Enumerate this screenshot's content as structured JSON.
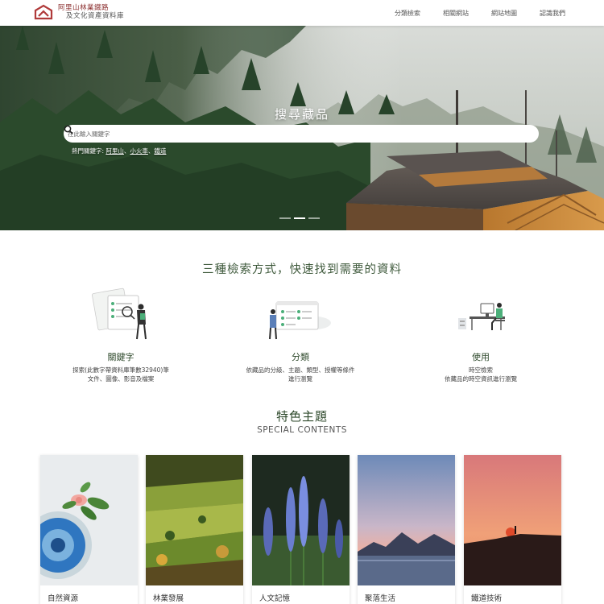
{
  "header": {
    "logo_line1": "阿里山林業鐵路",
    "logo_line2": "及文化資產資料庫",
    "nav": [
      "分類檢索",
      "相關網站",
      "網站地圖",
      "認識我們"
    ]
  },
  "hero": {
    "title": "搜尋藏品",
    "search_placeholder": "在此輸入關鍵字",
    "hot_keywords_label": "熱門關鍵字:",
    "hot_keywords": [
      "阿里山",
      "小火車",
      "鐵道"
    ],
    "hot_keywords_sep": "、",
    "slides": 3,
    "active_slide": 2
  },
  "methods": {
    "title": "三種檢索方式，快速找到需要的資料",
    "items": [
      {
        "icon": "keyword-search-illustration",
        "title": "關鍵字",
        "desc1": "探索(此數字帶資料庫筆數32940)筆",
        "desc2": "文件、圖像、影音及檔案"
      },
      {
        "icon": "category-illustration",
        "title": "分類",
        "desc1": "依藏品的分級、主題、類型、授權等條件",
        "desc2": "進行瀏覽"
      },
      {
        "icon": "usage-illustration",
        "title": "使用",
        "desc1": "時空檢索",
        "desc2": "依藏品的時空資訊進行瀏覽"
      }
    ]
  },
  "featured": {
    "title": "特色主題",
    "subtitle": "SPECIAL CONTENTS",
    "cards": [
      "自然資源",
      "林業發展",
      "人文記憶",
      "聚落生活",
      "鐵道技術"
    ]
  },
  "colors": {
    "accent_green": "#3f5a3c",
    "logo_red": "#8b2e2e"
  }
}
